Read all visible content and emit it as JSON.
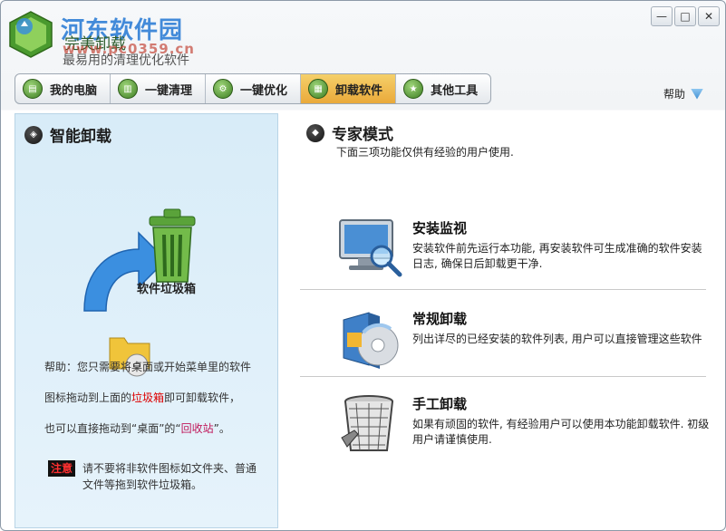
{
  "watermark": {
    "title": "河东软件园",
    "url": "www.pc0359.cn"
  },
  "app": {
    "title": "完美卸载",
    "subtitle": "最易用的清理优化软件"
  },
  "window_buttons": {
    "minimize": "—",
    "maximize": "□",
    "close": "✕"
  },
  "tabs": [
    {
      "label": "我的电脑",
      "icon": "computer-icon",
      "active": false
    },
    {
      "label": "一键清理",
      "icon": "trash-icon",
      "active": false
    },
    {
      "label": "一键优化",
      "icon": "optimize-icon",
      "active": false
    },
    {
      "label": "卸载软件",
      "icon": "uninstall-icon",
      "active": true
    },
    {
      "label": "其他工具",
      "icon": "tools-icon",
      "active": false
    }
  ],
  "help": {
    "label": "帮助"
  },
  "left": {
    "title": "智能卸载",
    "trash_label": "软件垃圾箱",
    "help_line1": "帮助：您只需要将桌面或开始菜单里的软件",
    "help_line2_a": "图标拖动到上面的",
    "help_line2_b": "垃圾箱",
    "help_line2_c": "即可卸载软件，",
    "help_line3_a": "也可以直接拖动到“桌面”的“",
    "help_line3_b": "回收站",
    "help_line3_c": "”。",
    "note_badge": "注意",
    "note_text": "请不要将非软件图标如文件夹、普通文件等拖到软件垃圾箱。"
  },
  "right": {
    "title": "专家模式",
    "desc": "下面三项功能仅供有经验的用户使用.",
    "items": [
      {
        "title": "安装监视",
        "desc": "安装软件前先运行本功能, 再安装软件可生成准确的软件安装日志, 确保日后卸载更干净.",
        "icon": "monitor-magnifier-icon"
      },
      {
        "title": "常规卸载",
        "desc": "列出详尽的已经安装的软件列表, 用户可以直接管理这些软件",
        "icon": "software-box-icon"
      },
      {
        "title": "手工卸载",
        "desc": "如果有顽固的软件, 有经验用户可以使用本功能卸载软件. 初级用户请谨慎使用.",
        "icon": "wastebasket-wrench-icon"
      }
    ]
  },
  "colors": {
    "accent_tab": "#eaa93a",
    "left_panel": "#d8ecf8",
    "watermark_blue": "#2f7fd6",
    "note_red": "#ff3030"
  }
}
